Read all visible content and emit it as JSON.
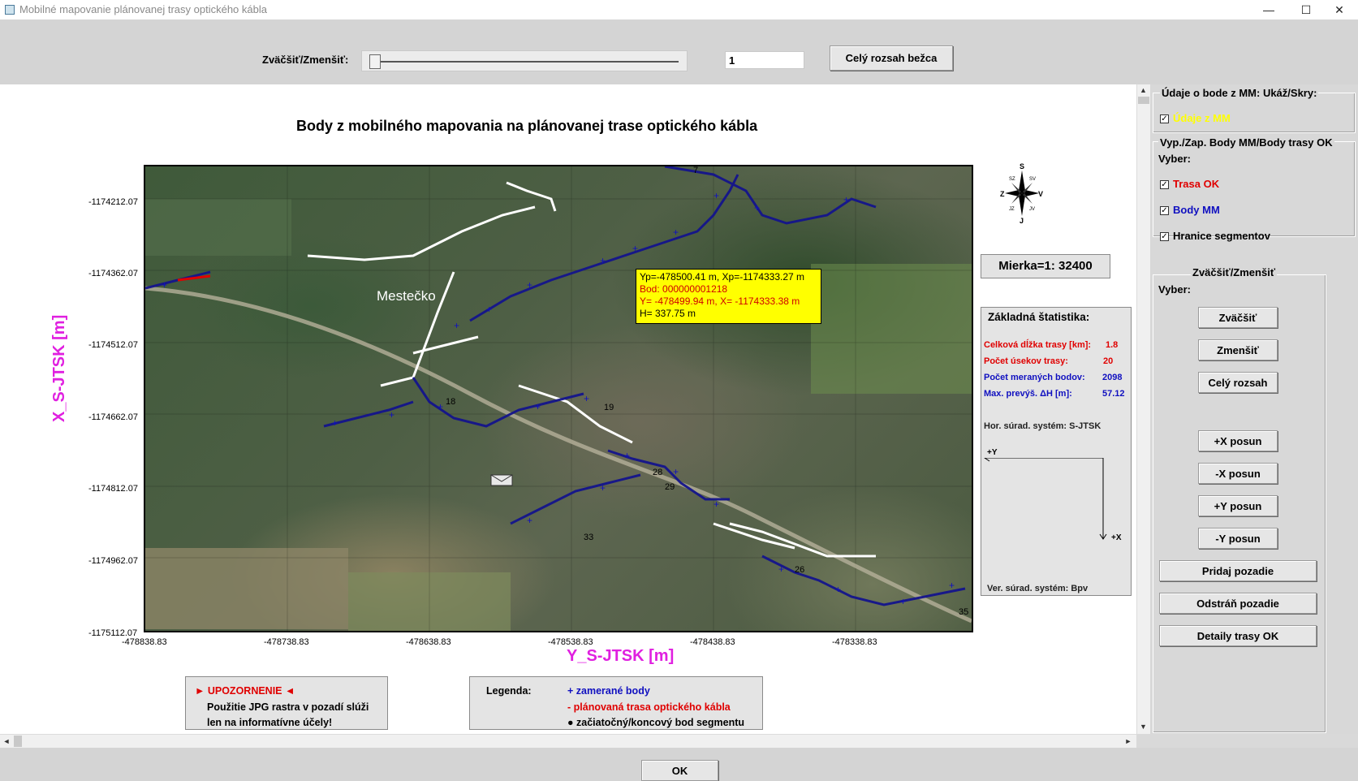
{
  "window": {
    "title": "Mobilné mapovanie plánovanej trasy optického kábla",
    "minimize_glyph": "—",
    "maximize_glyph": "☐",
    "close_glyph": "✕"
  },
  "toolbar": {
    "zoom_label": "Zväčšiť/Zmenšiť:",
    "zoom_value": "1",
    "full_range_label": "Celý rozsah bežca",
    "slider_level": 0.0
  },
  "plot": {
    "title": "Body z mobilného mapovania na plánovanej trase optického kábla",
    "ylabel": "X_S-JTSK [m]",
    "xlabel": "Y_S-JTSK [m]",
    "yticks": [
      "-1174212.07",
      "-1174362.07",
      "-1174512.07",
      "-1174662.07",
      "-1174812.07",
      "-1174962.07",
      "-1175112.07"
    ],
    "xticks": [
      "-478838.83",
      "-478738.83",
      "-478638.83",
      "-478538.83",
      "-478438.83",
      "-478338.83"
    ],
    "place_label": "Mestečko",
    "segment_labels": [
      "7",
      "18",
      "19",
      "28",
      "29",
      "33",
      "26",
      "35"
    ]
  },
  "tooltip": {
    "line1": "Yp=-478500.41 m, Xp=-1174333.27 m",
    "line2": "Bod: 000000001218",
    "line3": "Y= -478499.94 m, X= -1174333.38 m",
    "line4": "H=   337.75 m"
  },
  "compass": {
    "north": "S",
    "south": "J",
    "west": "Z",
    "east": "V",
    "nw": "SZ",
    "ne": "SV",
    "sw": "JZ",
    "se": "JV"
  },
  "scale": {
    "label": "Mierka=1: 32400"
  },
  "stats": {
    "title": "Základná štatistika:",
    "total_length_label": "Celková dĺžka trasy [km]:",
    "total_length_value": "1.8",
    "segments_label": "Počet úsekov trasy:",
    "segments_value": "20",
    "points_label": "Počet meraných bodov:",
    "points_value": "2098",
    "max_dh_label": "Max. prevýš. ΔH [m]:",
    "max_dh_value": "57.12",
    "hor_system": "Hor. súrad. systém: S-JTSK",
    "axis_y": "+Y",
    "axis_x": "+X",
    "ver_system": "Ver. súrad. systém: Bpv"
  },
  "warning": {
    "title": "► UPOZORNENIE ◄",
    "line1": "Použitie JPG rastra v pozadí slúži",
    "line2": "len na informatívne účely!"
  },
  "legend": {
    "title": "Legenda:",
    "item1": "+ zamerané body",
    "item2": "- plánovaná trasa optického kábla",
    "item3": "● začiatočný/koncový bod segmentu"
  },
  "panel": {
    "point_data_title": "Údaje o bode z MM: Ukáž/Skry:",
    "point_data_check": "Údaje z MM",
    "toggle_title": "Vyp./Zap. Body MM/Body trasy OK",
    "toggle_select": "Vyber:",
    "check_trasa": "Trasa OK",
    "check_body": "Body MM",
    "check_hranice": "Hranice segmentov",
    "zoom_group_title": "Zväčšiť/Zmenšiť",
    "zoom_select": "Vyber:",
    "btn_zoom_in": "Zväčšiť",
    "btn_zoom_out": "Zmenšiť",
    "btn_full": "Celý rozsah",
    "btn_px": "+X posun",
    "btn_mx": "-X posun",
    "btn_py": "+Y posun",
    "btn_my": "-Y posun",
    "btn_add_bg": "Pridaj pozadie",
    "btn_remove_bg": "Odstráň pozadie",
    "btn_details": "Detaily trasy OK",
    "check_mark": "✓"
  },
  "footer": {
    "ok_label": "OK"
  },
  "scroll": {
    "up": "▲",
    "down": "▼",
    "left": "◄",
    "right": "►"
  },
  "colors": {
    "magenta": "#e020e0",
    "red": "#e00000",
    "blue": "#1010c0",
    "yellow": "#ffff00",
    "route_blue": "#14148c"
  }
}
